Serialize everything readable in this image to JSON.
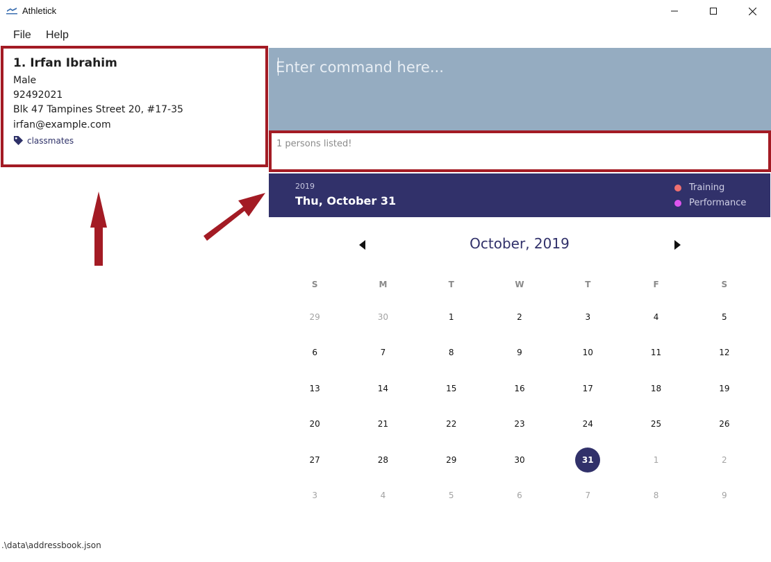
{
  "window": {
    "title": "Athletick",
    "minimize_icon": "minimize-icon",
    "maximize_icon": "maximize-icon",
    "close_icon": "close-icon"
  },
  "menu": {
    "items": [
      {
        "label": "File"
      },
      {
        "label": "Help"
      }
    ]
  },
  "person": {
    "index_name": "1.  Irfan Ibrahim",
    "gender": "Male",
    "phone": "92492021",
    "address": "Blk 47 Tampines Street 20, #17-35",
    "email": "irfan@example.com",
    "tag": "classmates"
  },
  "command": {
    "placeholder": "Enter command here..."
  },
  "result": {
    "text": "1 persons listed!"
  },
  "calendar_header": {
    "year": "2019",
    "date": "Thu, October 31",
    "legend": [
      {
        "label": "Training",
        "color": "#f07070"
      },
      {
        "label": "Performance",
        "color": "#dd55ee"
      }
    ],
    "background": "#31316a"
  },
  "calendar": {
    "month_title": "October, 2019",
    "weekdays": [
      "S",
      "M",
      "T",
      "W",
      "T",
      "F",
      "S"
    ],
    "weeks": [
      [
        {
          "d": "29",
          "muted": true
        },
        {
          "d": "30",
          "muted": true
        },
        {
          "d": "1"
        },
        {
          "d": "2"
        },
        {
          "d": "3"
        },
        {
          "d": "4"
        },
        {
          "d": "5"
        }
      ],
      [
        {
          "d": "6"
        },
        {
          "d": "7"
        },
        {
          "d": "8"
        },
        {
          "d": "9"
        },
        {
          "d": "10"
        },
        {
          "d": "11"
        },
        {
          "d": "12"
        }
      ],
      [
        {
          "d": "13"
        },
        {
          "d": "14"
        },
        {
          "d": "15"
        },
        {
          "d": "16"
        },
        {
          "d": "17"
        },
        {
          "d": "18"
        },
        {
          "d": "19"
        }
      ],
      [
        {
          "d": "20"
        },
        {
          "d": "21"
        },
        {
          "d": "22"
        },
        {
          "d": "23"
        },
        {
          "d": "24"
        },
        {
          "d": "25"
        },
        {
          "d": "26"
        }
      ],
      [
        {
          "d": "27"
        },
        {
          "d": "28"
        },
        {
          "d": "29"
        },
        {
          "d": "30"
        },
        {
          "d": "31",
          "selected": true
        },
        {
          "d": "1",
          "muted": true
        },
        {
          "d": "2",
          "muted": true
        }
      ],
      [
        {
          "d": "3",
          "muted": true
        },
        {
          "d": "4",
          "muted": true
        },
        {
          "d": "5",
          "muted": true
        },
        {
          "d": "6",
          "muted": true
        },
        {
          "d": "7",
          "muted": true
        },
        {
          "d": "8",
          "muted": true
        },
        {
          "d": "9",
          "muted": true
        }
      ]
    ]
  },
  "status": {
    "path": ".\\data\\addressbook.json"
  },
  "colors": {
    "highlight_border": "#a31b24",
    "command_bg": "#95acc1",
    "accent": "#31316a"
  }
}
